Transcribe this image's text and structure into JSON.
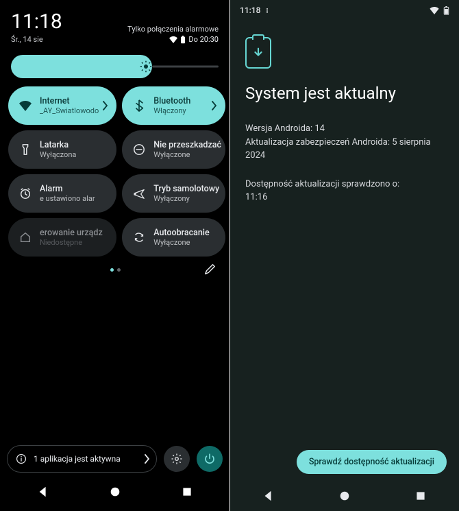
{
  "left": {
    "time": "11:18",
    "alarm_only": "Tylko połączenia alarmowe",
    "date": "Śr., 14 sie",
    "until": "Do 20:30",
    "tiles": {
      "internet": {
        "label": "Internet",
        "sub": "_AY_Swiatlowodo"
      },
      "bluetooth": {
        "label": "Bluetooth",
        "sub": "Włączony"
      },
      "flashlight": {
        "label": "Latarka",
        "sub": "Wyłączona"
      },
      "dnd": {
        "label": "Nie przeszkadzać",
        "sub": "Wyłączone"
      },
      "alarm": {
        "label": "Alarm",
        "sub": "e ustawiono alar"
      },
      "airplane": {
        "label": "Tryb samolotowy",
        "sub": "Wyłączony"
      },
      "homectl": {
        "label": "erowanie urządz",
        "sub": "Niedostępne"
      },
      "rotate": {
        "label": "Autoobracanie",
        "sub": "Wyłączone"
      }
    },
    "notif": "1 aplikacja jest aktywna"
  },
  "right": {
    "time": "11:18",
    "title": "System jest aktualny",
    "ver_line": "Wersja Androida: 14",
    "sec_line": "Aktualizacja zabezpieczeń Androida: 5 sierpnia 2024",
    "checked_label": "Dostępność aktualizacji sprawdzono o:",
    "checked_time": "11:16",
    "cta": "Sprawdź dostępność aktualizacji"
  }
}
